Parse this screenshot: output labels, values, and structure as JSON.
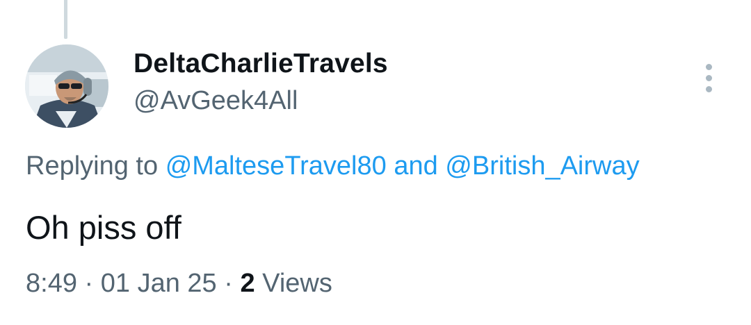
{
  "tweet": {
    "author": {
      "display_name": "DeltaCharlieTravels",
      "handle": "@AvGeek4All",
      "avatar_icon": "pilot-avatar"
    },
    "more_icon": "more-vertical-icon",
    "reply_context": {
      "prefix": "Replying to",
      "mentions": [
        "@MalteseTravel80",
        "@British_Airway"
      ],
      "conjunction": "and"
    },
    "text": "Oh piss off",
    "meta": {
      "time": "8:49",
      "separator": "·",
      "date": "01 Jan 25",
      "views_count": "2",
      "views_label": "Views"
    }
  },
  "colors": {
    "link": "#1d9bf0",
    "secondary_text": "#536471",
    "primary_text": "#0f1419",
    "thread_line": "#cfd9de"
  }
}
